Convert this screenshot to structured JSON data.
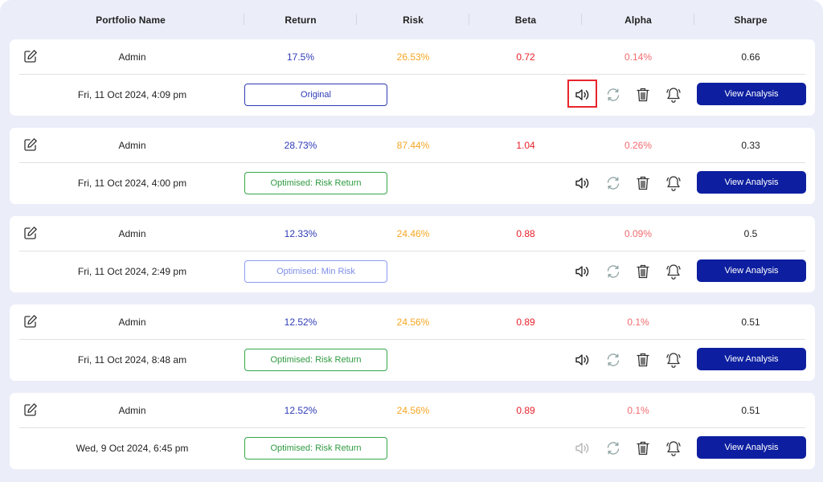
{
  "header": {
    "columns": [
      "Portfolio Name",
      "Return",
      "Risk",
      "Beta",
      "Alpha",
      "Sharpe"
    ]
  },
  "colors": {
    "return": "#2e3bb5",
    "risk": "#f5a623",
    "beta": "#e8202a",
    "alpha": "#f26b6f",
    "view_button": "#0d1fa0",
    "highlight": "#e8252b"
  },
  "icons": {
    "edit": "edit-icon",
    "speaker": "speaker-icon",
    "refresh": "refresh-icon",
    "trash": "trash-icon",
    "bell": "bell-icon"
  },
  "portfolios": [
    {
      "name": "Admin",
      "return": "17.5%",
      "risk": "26.53%",
      "beta": "0.72",
      "alpha": "0.14%",
      "sharpe": "0.66",
      "date": "Fri, 11 Oct 2024, 4:09 pm",
      "type": "Original",
      "type_style": "original",
      "speaker_enabled": true,
      "speaker_highlighted": true,
      "view_label": "View Analysis"
    },
    {
      "name": "Admin",
      "return": "28.73%",
      "risk": "87.44%",
      "beta": "1.04",
      "alpha": "0.26%",
      "sharpe": "0.33",
      "date": "Fri, 11 Oct 2024, 4:00 pm",
      "type": "Optimised: Risk Return",
      "type_style": "riskret",
      "speaker_enabled": true,
      "speaker_highlighted": false,
      "view_label": "View Analysis"
    },
    {
      "name": "Admin",
      "return": "12.33%",
      "risk": "24.46%",
      "beta": "0.88",
      "alpha": "0.09%",
      "sharpe": "0.5",
      "date": "Fri, 11 Oct 2024, 2:49 pm",
      "type": "Optimised: Min Risk",
      "type_style": "minrisk",
      "speaker_enabled": true,
      "speaker_highlighted": false,
      "view_label": "View Analysis"
    },
    {
      "name": "Admin",
      "return": "12.52%",
      "risk": "24.56%",
      "beta": "0.89",
      "alpha": "0.1%",
      "sharpe": "0.51",
      "date": "Fri, 11 Oct 2024, 8:48 am",
      "type": "Optimised: Risk Return",
      "type_style": "riskret",
      "speaker_enabled": true,
      "speaker_highlighted": false,
      "view_label": "View Analysis"
    },
    {
      "name": "Admin",
      "return": "12.52%",
      "risk": "24.56%",
      "beta": "0.89",
      "alpha": "0.1%",
      "sharpe": "0.51",
      "date": "Wed, 9 Oct 2024, 6:45 pm",
      "type": "Optimised: Risk Return",
      "type_style": "riskret",
      "speaker_enabled": false,
      "speaker_highlighted": false,
      "view_label": "View Analysis"
    }
  ]
}
